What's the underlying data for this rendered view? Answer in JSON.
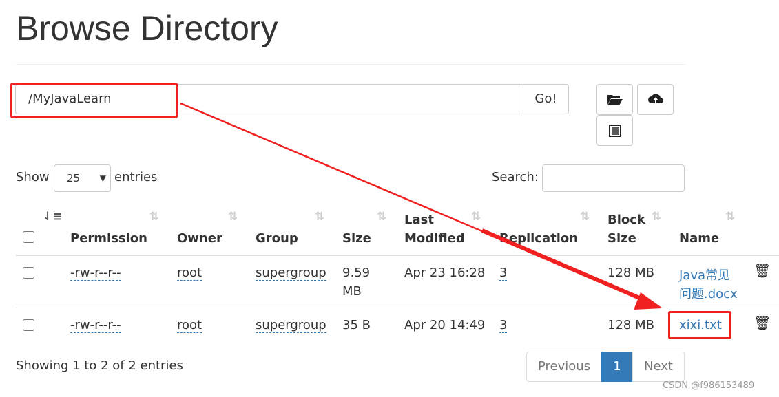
{
  "title": "Browse Directory",
  "path_input": {
    "value": "/MyJavaLearn"
  },
  "go_label": "Go!",
  "toolbar": {
    "icons": [
      "folder-open-icon",
      "cloud-upload-icon",
      "list-icon"
    ]
  },
  "length": {
    "show": "Show",
    "value": "25",
    "entries": "entries"
  },
  "search": {
    "label": "Search:",
    "value": ""
  },
  "columns": [
    "Permission",
    "Owner",
    "Group",
    "Size",
    "Last",
    "Modified",
    "Replication",
    "Block",
    "Size",
    "Name"
  ],
  "rows": [
    {
      "permission": "-rw-r--r--",
      "owner": "root",
      "group": "supergroup",
      "size1": "9.59",
      "size2": "MB",
      "modified": "Apr 23 16:28",
      "replication": "3",
      "block": "128 MB",
      "name1": "Java常见",
      "name2": "问题.docx"
    },
    {
      "permission": "-rw-r--r--",
      "owner": "root",
      "group": "supergroup",
      "size1": "35 B",
      "size2": "",
      "modified": "Apr 20 14:49",
      "replication": "3",
      "block": "128 MB",
      "name1": "xixi.txt",
      "name2": ""
    }
  ],
  "footer": {
    "info": "Showing 1 to 2 of 2 entries",
    "previous": "Previous",
    "page": "1",
    "next": "Next"
  },
  "watermark": "CSDN @f986153489",
  "colors": {
    "link": "#337ab7",
    "annotation": "#f02020",
    "active_page": "#337ab7"
  }
}
